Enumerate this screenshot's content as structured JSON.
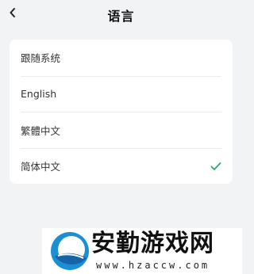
{
  "header": {
    "title": "语言"
  },
  "languages": [
    {
      "label": "跟随系统",
      "selected": false
    },
    {
      "label": "English",
      "selected": false
    },
    {
      "label": "繁體中文",
      "selected": false
    },
    {
      "label": "简体中文",
      "selected": true
    }
  ],
  "colors": {
    "accent": "#2faa6e",
    "background": "#f2f3f5"
  },
  "watermark": {
    "title": "安勤游戏网",
    "url": "www.hzaccw.com"
  }
}
